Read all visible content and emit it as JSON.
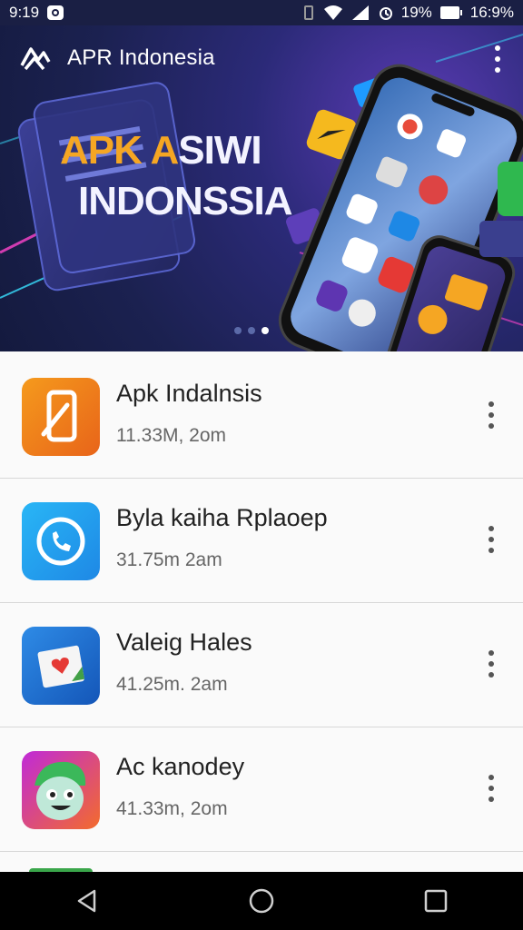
{
  "status_bar": {
    "time": "9:19",
    "battery_text_1": "19%",
    "battery_text_2": "16:9%"
  },
  "toolbar": {
    "title": "APR Indonesia",
    "more_icon": "more-vert-icon",
    "logo_icon": "app-logo-icon"
  },
  "banner": {
    "line1_orange": "APK A",
    "line1_white": "SIWI",
    "line2": "INDONSSIA",
    "page_indicator": {
      "count": 3,
      "active_index": 2
    }
  },
  "apps": [
    {
      "name": "Apk Indalnsis",
      "meta": "11.33M, 2om",
      "icon": "phone-edit-icon",
      "color": "#f07d1a"
    },
    {
      "name": "Byla kaiha Rplaoep",
      "meta": "31.75m  2am",
      "icon": "phone-call-icon",
      "color": "#1e9be8"
    },
    {
      "name": "Valeig Hales",
      "meta": "41.25m. 2am",
      "icon": "photo-heart-icon",
      "color": "#1b73d6"
    },
    {
      "name": "Ac kanodey",
      "meta": "41.33m, 2om",
      "icon": "cartoon-face-icon",
      "color": "#8a2bd8"
    }
  ],
  "nav": {
    "back_icon": "back-triangle-icon",
    "home_icon": "home-circle-icon",
    "recents_icon": "recents-square-icon"
  },
  "colors": {
    "header_bg": "#1b2150",
    "accent_orange": "#f5a623",
    "list_bg": "#fafafa"
  }
}
